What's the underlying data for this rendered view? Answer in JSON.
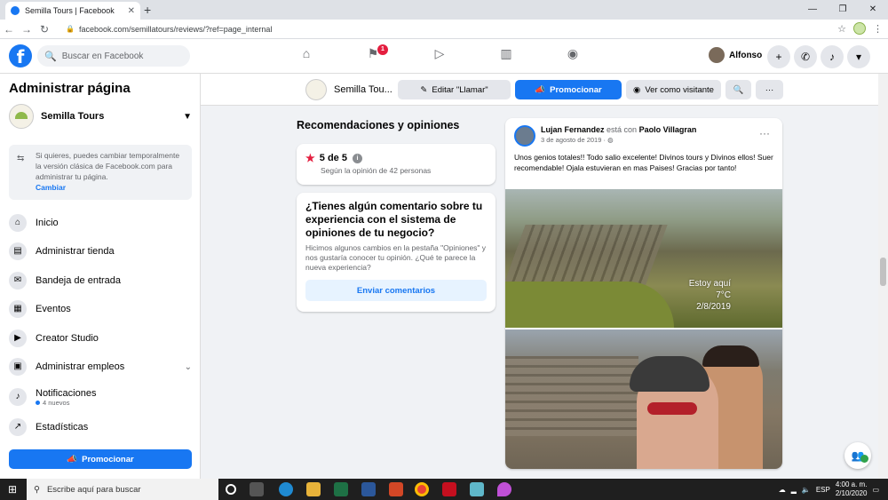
{
  "browser": {
    "tab_title": "Semilla Tours | Facebook",
    "url": "facebook.com/semillatours/reviews/?ref=page_internal",
    "win_controls": [
      "—",
      "❐",
      "✕"
    ]
  },
  "header": {
    "search_placeholder": "Buscar en Facebook",
    "notif_badge": "1",
    "profile_name": "Alfonso"
  },
  "sidebar": {
    "title": "Administrar página",
    "page_name": "Semilla Tours",
    "notice_text": "Si quieres, puedes cambiar temporalmente la versión clásica de Facebook.com para administrar tu página.",
    "notice_link": "Cambiar",
    "items": [
      {
        "label": "Inicio",
        "icon": "home-icon",
        "glyph": "⌂"
      },
      {
        "label": "Administrar tienda",
        "icon": "shop-icon",
        "glyph": "▤"
      },
      {
        "label": "Bandeja de entrada",
        "icon": "inbox-icon",
        "glyph": "✉"
      },
      {
        "label": "Eventos",
        "icon": "calendar-icon",
        "glyph": "▦"
      },
      {
        "label": "Creator Studio",
        "icon": "creator-icon",
        "glyph": "▶"
      },
      {
        "label": "Administrar empleos",
        "icon": "briefcase-icon",
        "glyph": "▣"
      },
      {
        "label": "Notificaciones",
        "icon": "bell-icon",
        "glyph": "🔔",
        "sub": "4 nuevos"
      },
      {
        "label": "Estadísticas",
        "icon": "chart-icon",
        "glyph": "↗"
      }
    ],
    "promote": "Promocionar"
  },
  "pagehead": {
    "name": "Semilla Tou...",
    "edit_btn": "Editar \"Llamar\"",
    "promote_btn": "Promocionar",
    "view_btn": "Ver como visitante",
    "more": "···"
  },
  "reviews": {
    "title": "Recomendaciones y opiniones",
    "rating": "5 de 5",
    "rating_sub": "Según la opinión de 42 personas",
    "feedback_q": "¿Tienes algún comentario sobre tu experiencia con el sistema de opiniones de tu negocio?",
    "feedback_d": "Hicimos algunos cambios en la pestaña \"Opiniones\" y nos gustaría conocer tu opinión. ¿Qué te parece la nueva experiencia?",
    "feedback_btn": "Enviar comentarios"
  },
  "post": {
    "author": "Lujan Fernandez",
    "with": "está con",
    "tagged": "Paolo Villagran",
    "date": "3 de agosto de 2019 · ",
    "text": "Unos genios totales!! Todo salio excelente! Divinos tours y Divinos ellos! Suer recomendable! Ojala estuvieran en mas Paises! Gracias por tanto!",
    "photo_caption": [
      "Estoy aquí",
      "7°C",
      "2/8/2019"
    ]
  },
  "taskbar": {
    "search": "Escribe aquí para buscar",
    "lang": "ESP",
    "time": "4:00 a. m.",
    "date": "2/10/2020"
  },
  "colors": {
    "fb_blue": "#1877f2",
    "badge_red": "#e41e3f"
  }
}
